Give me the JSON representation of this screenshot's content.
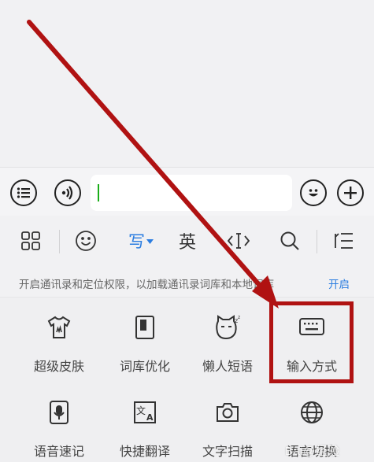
{
  "chat_bar": {
    "menu_icon": "list-icon",
    "voice_icon": "voice-icon",
    "input_value": "",
    "emoji_icon": "smile-icon",
    "add_icon": "plus-icon"
  },
  "toolbar": {
    "items": [
      {
        "icon": "grid-icon"
      },
      {
        "icon": "emoji-face-icon"
      },
      {
        "label": "写",
        "active": true
      },
      {
        "label": "英"
      },
      {
        "icon": "cursor-icon"
      },
      {
        "icon": "search-icon"
      },
      {
        "icon": "collapse-icon"
      }
    ]
  },
  "permission": {
    "text": "开启通讯录和定位权限，以加载通讯录词库和本地词库",
    "action": "开启"
  },
  "features": {
    "row1": [
      "超级皮肤",
      "词库优化",
      "懒人短语",
      "输入方式"
    ],
    "row2": [
      "语音速记",
      "快捷翻译",
      "文字扫描",
      "语言切换"
    ]
  },
  "colors": {
    "accent_blue": "#2b7de0",
    "annotation_red": "#b01212",
    "caret_green": "#1aad19"
  },
  "watermark": "Bai@经验"
}
